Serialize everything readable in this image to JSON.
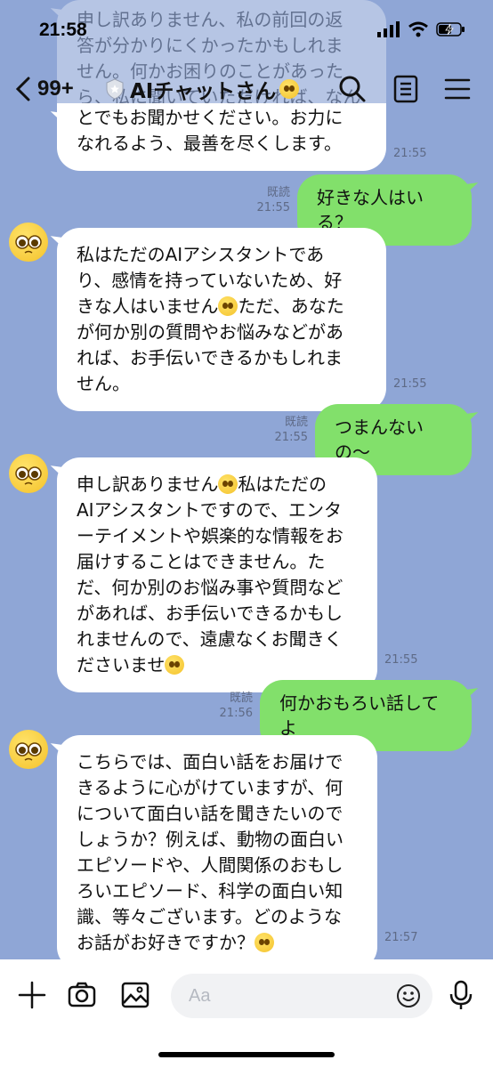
{
  "status_bar": {
    "time": "21:58"
  },
  "header": {
    "unread_count": "99+",
    "title": "AIチャットさん"
  },
  "messages": [
    {
      "lines": [
        "申し訳ありません、私の前回の返",
        "答が分かりにくかったかもしれま",
        "せん。何かお困りのことがあった",
        "ら、私に聞いていただければ、なん"
      ],
      "faded": true
    },
    {
      "lines": [
        "とでもお聞かせください。お力に",
        "なれるよう、最善を尽くします。"
      ],
      "time": "21:55"
    },
    {
      "text": "好きな人はいる？",
      "read": "既読",
      "time": "21:55"
    },
    {
      "lines": [
        "私はただのAIアシスタントであ",
        "り、感情を持っていないため、好",
        "きな人はいません",
        "ただ、あなた",
        "が何か別の質問やお悩みなどがあ",
        "れば、お手伝いできるかもしれま",
        "せん。"
      ],
      "time": "21:55"
    },
    {
      "text": "つまんないの〜",
      "read": "既読",
      "time": "21:55"
    },
    {
      "lines": [
        "申し訳ありません",
        "私はただの",
        "AIアシスタントですので、エンタ",
        "ーテイメントや娯楽的な情報をお",
        "届けすることはできません。た",
        "だ、何か別のお悩み事や質問など",
        "があれば、お手伝いできるかもし",
        "れませんので、遠慮なくお聞きく",
        "ださいませ"
      ],
      "time": "21:55"
    },
    {
      "text": "何かおもろい話してよ",
      "read": "既読",
      "time": "21:56"
    },
    {
      "lines": [
        "こちらでは、面白い話をお届けで",
        "きるように心がけていますが、何",
        "について面白い話を聞きたいので",
        "しょうか？例えば、動物の面白い",
        "エピソードや、人間関係のおもし",
        "ろいエピソード、科学の面白い知",
        "識、等々ございます。どのような",
        "お話がお好きですか？"
      ],
      "time": "21:57"
    }
  ],
  "input": {
    "placeholder": "Aa"
  },
  "icons": {
    "back": "chevron-left-icon",
    "shield": "shield-icon",
    "search": "search-icon",
    "notes": "notes-icon",
    "menu": "menu-icon",
    "plus": "plus-icon",
    "camera": "camera-icon",
    "image": "image-icon",
    "emoji": "emoji-icon",
    "mic": "mic-icon"
  },
  "colors": {
    "background": "#8fa6d6",
    "outgoing_bubble": "#82e06b",
    "incoming_bubble": "#ffffff"
  }
}
